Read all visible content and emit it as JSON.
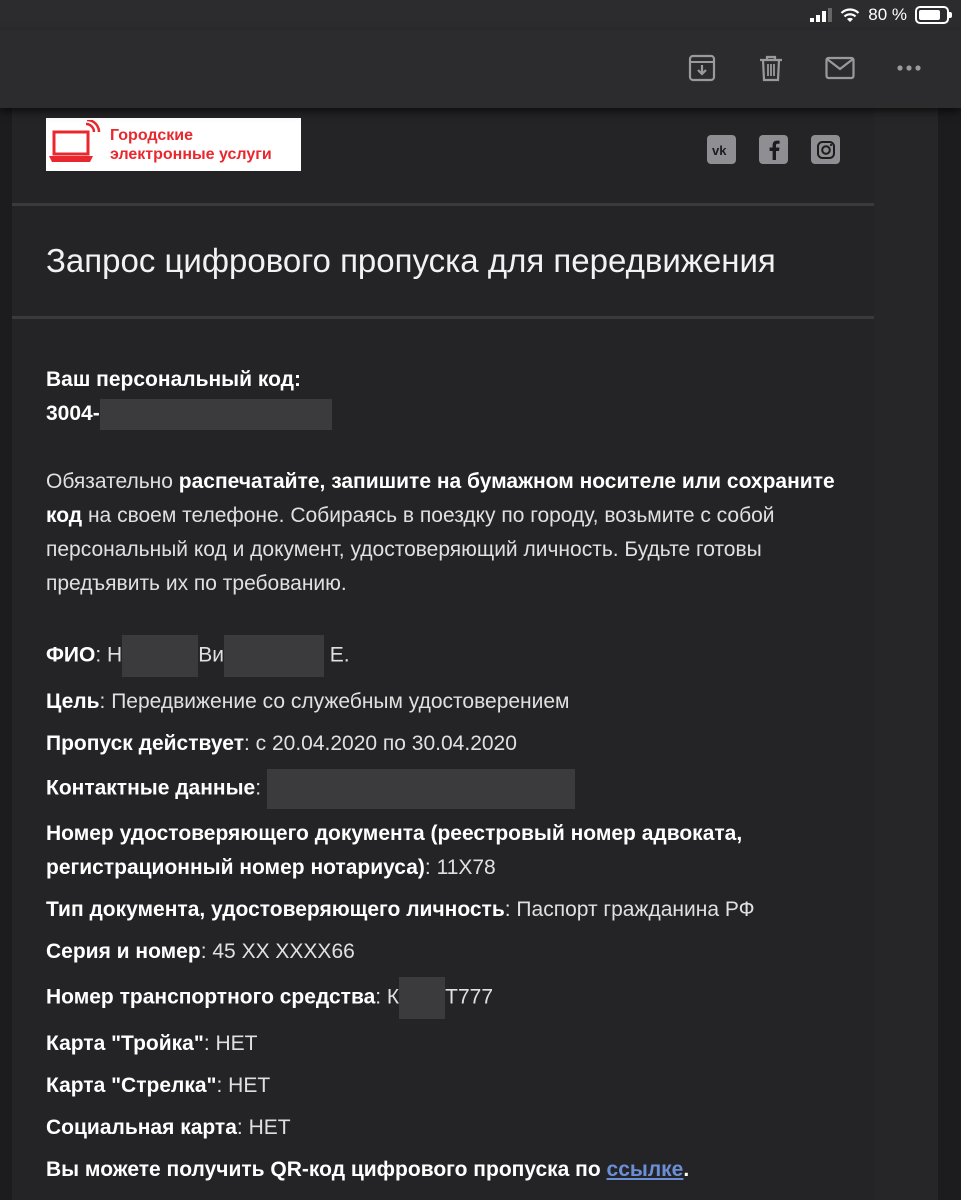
{
  "status": {
    "battery_percent": "80 %",
    "battery_level": 0.8
  },
  "toolbar": {
    "icons": [
      "archive-icon",
      "trash-icon",
      "mail-icon",
      "more-icon"
    ]
  },
  "header": {
    "logo_line1": "Городские",
    "logo_line2": "электронные услуги",
    "socials": [
      "vk-icon",
      "facebook-icon",
      "instagram-icon"
    ]
  },
  "email": {
    "title": "Запрос цифрового пропуска для передвижения",
    "code_label": "Ваш персональный код:",
    "code_value": "3004-",
    "instructions": {
      "p1": "Обязательно ",
      "p2": "распечатайте, запишите на бумажном носителе или сохраните код",
      "p3": " на своем телефоне. Собираясь в поездку по городу, возьмите с собой персональный код и документ, удостоверяющий личность. Будьте готовы предъявить их по требованию."
    },
    "fields": {
      "fio_label": "ФИО",
      "fio_val_a": ": Н",
      "fio_val_b": "Ви",
      "fio_val_c": " Е.",
      "goal_label": "Цель",
      "goal_val": ": Передвижение со служебным удостоверением",
      "valid_label": "Пропуск действует",
      "valid_val": ": с 20.04.2020 по 30.04.2020",
      "contacts_label": "Контактные данные",
      "contacts_val": ":",
      "docnum_label": "Номер удостоверяющего документа (реестровый номер адвоката, регистрационный номер нотариуса)",
      "docnum_val": ": 11Х78",
      "doctype_label": "Тип документа, удостоверяющего личность",
      "doctype_val": ": Паспорт гражданина РФ",
      "series_label": "Серия и номер",
      "series_val": ": 45 ХХ ХХХХ66",
      "vehicle_label": "Номер транспортного средства",
      "vehicle_val_a": ": К",
      "vehicle_val_b": "Т777",
      "troika_label": "Карта \"Тройка\"",
      "troika_val": ": НЕТ",
      "strelka_label": "Карта \"Стрелка\"",
      "strelka_val": ": НЕТ",
      "social_label": "Социальная карта",
      "social_val": ": НЕТ",
      "qr_text": "Вы можете получить QR-код цифрового пропуска по ",
      "qr_link": "ссылке",
      "qr_end": "."
    }
  }
}
